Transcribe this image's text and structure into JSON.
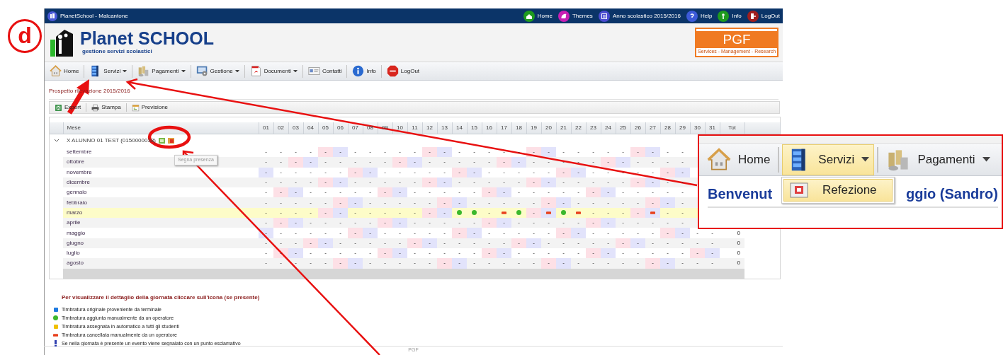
{
  "annotation": {
    "label": "d"
  },
  "window": {
    "title": "PlanetSchool - Malcantone"
  },
  "top_links": [
    {
      "label": "Home",
      "kind": "home",
      "color": "#1e9a1e"
    },
    {
      "label": "Themes",
      "kind": "themes",
      "color": "#c81eb4"
    },
    {
      "label": "Anno scolastico 2015/2016",
      "kind": "calendar",
      "color": "#4a4ad0"
    },
    {
      "label": "Help",
      "kind": "help",
      "color": "#3c5ad8"
    },
    {
      "label": "Info",
      "kind": "info",
      "color": "#1e9a1e"
    },
    {
      "label": "LogOut",
      "kind": "logout",
      "color": "#a01e1e"
    }
  ],
  "brand": {
    "title": "Planet SCHOOL",
    "subtitle": "gestione servizi scolastici"
  },
  "partner_logo": {
    "text": "PGF",
    "tagline": "Services - Management - Research"
  },
  "toolbar": [
    {
      "label": "Home",
      "kind": "home",
      "dropdown": false
    },
    {
      "label": "Servizi",
      "kind": "services",
      "dropdown": true
    },
    {
      "label": "Pagamenti",
      "kind": "payments",
      "dropdown": true
    },
    {
      "label": "Gestione",
      "kind": "management",
      "dropdown": true
    },
    {
      "label": "Documenti",
      "kind": "documents",
      "dropdown": true
    },
    {
      "label": "Contatti",
      "kind": "contacts",
      "dropdown": false
    },
    {
      "label": "Info",
      "kind": "info",
      "dropdown": false
    },
    {
      "label": "LogOut",
      "kind": "logout",
      "dropdown": false
    }
  ],
  "page_title": "Prospetto rilevazione 2015/2016",
  "actions": [
    {
      "label": "Export",
      "kind": "excel"
    },
    {
      "label": "Stampa",
      "kind": "print"
    },
    {
      "label": "Previsione",
      "kind": "forecast"
    }
  ],
  "grid": {
    "columns": [
      "Mese",
      "01",
      "02",
      "03",
      "04",
      "05",
      "06",
      "07",
      "08",
      "09",
      "10",
      "11",
      "12",
      "13",
      "14",
      "15",
      "16",
      "17",
      "18",
      "19",
      "20",
      "21",
      "22",
      "23",
      "24",
      "25",
      "26",
      "27",
      "28",
      "29",
      "30",
      "31",
      "Tot"
    ],
    "group": {
      "label": "X ALUNNO 01 TEST (0150000038)",
      "expanded": true
    },
    "tooltip": "Segna presenza",
    "rows": [
      {
        "selected": false,
        "cells": [
          "settembre",
          "-",
          "-",
          "-",
          "-",
          {
            "text": "-",
            "color": "#fde0e6"
          },
          {
            "text": "-",
            "color": "#e2e3fb"
          },
          "-",
          "-",
          "-",
          "-",
          "-",
          {
            "text": "-",
            "color": "#fde0e6"
          },
          {
            "text": "-",
            "color": "#e2e3fb"
          },
          "-",
          "-",
          "-",
          "-",
          "-",
          {
            "text": "-",
            "color": "#fde0e6"
          },
          {
            "text": "-",
            "color": "#e2e3fb"
          },
          "-",
          "-",
          "-",
          "-",
          "-",
          {
            "text": "-",
            "color": "#fde0e6"
          },
          {
            "text": "-",
            "color": "#e2e3fb"
          },
          "-",
          "-"
        ]
      },
      {
        "selected": false,
        "cells": [
          "ottobre",
          "-",
          "-",
          {
            "text": "-",
            "color": "#fde0e6"
          },
          {
            "text": "-",
            "color": "#e2e3fb"
          },
          "-",
          "-",
          "-",
          "-",
          "-",
          {
            "text": "-",
            "color": "#fde0e6"
          },
          {
            "text": "-",
            "color": "#e2e3fb"
          },
          "-",
          "-",
          "-",
          "-",
          "-",
          {
            "text": "-",
            "color": "#fde0e6"
          },
          {
            "text": "-",
            "color": "#e2e3fb"
          },
          "-",
          "-",
          "-",
          "-",
          "-",
          {
            "text": "-",
            "color": "#fde0e6"
          },
          {
            "text": "-",
            "color": "#e2e3fb"
          },
          "-",
          "-",
          "-",
          "-"
        ]
      },
      {
        "selected": false,
        "cells": [
          "novembre",
          {
            "text": "-",
            "color": "#e2e3fb"
          },
          "-",
          "-",
          "-",
          "-",
          "-",
          {
            "text": "-",
            "color": "#fde0e6"
          },
          {
            "text": "-",
            "color": "#e2e3fb"
          },
          "-",
          "-",
          "-",
          "-",
          "-",
          {
            "text": "-",
            "color": "#fde0e6"
          },
          {
            "text": "-",
            "color": "#e2e3fb"
          },
          "-",
          "-",
          "-",
          "-",
          "-",
          {
            "text": "-",
            "color": "#fde0e6"
          },
          {
            "text": "-",
            "color": "#e2e3fb"
          },
          "-",
          "-",
          "-",
          "-",
          "-",
          {
            "text": "-",
            "color": "#fde0e6"
          },
          {
            "text": "-",
            "color": "#e2e3fb"
          }
        ]
      },
      {
        "selected": false,
        "cells": [
          "dicembre",
          "-",
          "-",
          "-",
          "-",
          {
            "text": "-",
            "color": "#fde0e6"
          },
          {
            "text": "-",
            "color": "#e2e3fb"
          },
          "-",
          "-",
          "-",
          "-",
          "-",
          {
            "text": "-",
            "color": "#fde0e6"
          },
          {
            "text": "-",
            "color": "#e2e3fb"
          },
          "-",
          "-",
          "-",
          "-",
          "-",
          {
            "text": "-",
            "color": "#fde0e6"
          },
          {
            "text": "-",
            "color": "#e2e3fb"
          },
          "-",
          "-",
          "-",
          "-",
          "-",
          {
            "text": "-",
            "color": "#fde0e6"
          },
          {
            "text": "-",
            "color": "#e2e3fb"
          },
          "-",
          "-"
        ]
      },
      {
        "selected": false,
        "cells": [
          "gennaio",
          "-",
          {
            "text": "-",
            "color": "#fde0e6"
          },
          {
            "text": "-",
            "color": "#e2e3fb"
          },
          "-",
          "-",
          "-",
          "-",
          "-",
          {
            "text": "-",
            "color": "#fde0e6"
          },
          {
            "text": "-",
            "color": "#e2e3fb"
          },
          "-",
          "-",
          "-",
          "-",
          "-",
          {
            "text": "-",
            "color": "#fde0e6"
          },
          {
            "text": "-",
            "color": "#e2e3fb"
          },
          "-",
          "-",
          "-",
          "-",
          "-",
          {
            "text": "-",
            "color": "#fde0e6"
          },
          {
            "text": "-",
            "color": "#e2e3fb"
          },
          "-",
          "-",
          "-",
          "-",
          "-"
        ]
      },
      {
        "selected": false,
        "cells": [
          "febbraio",
          "-",
          "-",
          "-",
          "-",
          "-",
          {
            "text": "-",
            "color": "#fde0e6"
          },
          {
            "text": "-",
            "color": "#e2e3fb"
          },
          "-",
          "-",
          "-",
          "-",
          "-",
          {
            "text": "-",
            "color": "#fde0e6"
          },
          {
            "text": "-",
            "color": "#e2e3fb"
          },
          "-",
          "-",
          "-",
          "-",
          "-",
          {
            "text": "-",
            "color": "#fde0e6"
          },
          {
            "text": "-",
            "color": "#e2e3fb"
          },
          "-",
          "-",
          "-",
          "-",
          "-",
          {
            "text": "-",
            "color": "#fde0e6"
          },
          {
            "text": "-",
            "color": "#e2e3fb"
          },
          "-"
        ]
      },
      {
        "selected": true,
        "cells": [
          "marzo",
          "-",
          "-",
          "-",
          "-",
          {
            "text": "-",
            "color": "#fde0e6"
          },
          {
            "text": "-",
            "color": "#e2e3fb"
          },
          "-",
          "-",
          "-",
          "-",
          "-",
          {
            "text": "-",
            "color": "#fde0e6"
          },
          {
            "text": "-",
            "color": "#e2e3fb"
          },
          {
            "kind": "added"
          },
          {
            "kind": "added"
          },
          "-",
          {
            "kind": "cancelled"
          },
          {
            "kind": "added"
          },
          {
            "text": "-",
            "color": "#fde0e6"
          },
          {
            "kind": "cancelled",
            "color": "#e2e3fb"
          },
          {
            "kind": "added"
          },
          {
            "kind": "cancelled"
          },
          "-",
          "-",
          "-",
          {
            "text": "-",
            "color": "#fde0e6"
          },
          {
            "kind": "cancelled",
            "color": "#e2e3fb"
          },
          "-",
          "-"
        ]
      },
      {
        "selected": false,
        "cells": [
          "aprile",
          "-",
          {
            "text": "-",
            "color": "#fde0e6"
          },
          {
            "text": "-",
            "color": "#e2e3fb"
          },
          "-",
          "-",
          "-",
          "-",
          "-",
          {
            "text": "-",
            "color": "#fde0e6"
          },
          {
            "text": "-",
            "color": "#e2e3fb"
          },
          "-",
          "-",
          "-",
          "-",
          "-",
          {
            "text": "-",
            "color": "#fde0e6"
          },
          {
            "text": "-",
            "color": "#e2e3fb"
          },
          "-",
          "-",
          "-",
          "-",
          "-",
          {
            "text": "-",
            "color": "#fde0e6"
          },
          {
            "text": "-",
            "color": "#e2e3fb"
          },
          "-",
          "-",
          "-",
          "-",
          "-"
        ]
      },
      {
        "selected": false,
        "cells": [
          "maggio",
          {
            "text": "-",
            "color": "#e2e3fb"
          },
          "-",
          "-",
          "-",
          "-",
          "-",
          {
            "text": "-",
            "color": "#fde0e6"
          },
          {
            "text": "-",
            "color": "#e2e3fb"
          },
          "-",
          "-",
          "-",
          "-",
          "-",
          {
            "text": "-",
            "color": "#fde0e6"
          },
          {
            "text": "-",
            "color": "#e2e3fb"
          },
          "-",
          "-",
          "-",
          "-",
          "-",
          {
            "text": "-",
            "color": "#fde0e6"
          },
          {
            "text": "-",
            "color": "#e2e3fb"
          },
          "-",
          "-",
          "-",
          "-",
          "-",
          {
            "text": "-",
            "color": "#fde0e6"
          },
          {
            "text": "-",
            "color": "#e2e3fb"
          },
          "-",
          "-",
          "0"
        ]
      },
      {
        "selected": false,
        "cells": [
          "giugno",
          "-",
          "-",
          "-",
          {
            "text": "-",
            "color": "#fde0e6"
          },
          {
            "text": "-",
            "color": "#e2e3fb"
          },
          "-",
          "-",
          "-",
          "-",
          "-",
          {
            "text": "-",
            "color": "#fde0e6"
          },
          {
            "text": "-",
            "color": "#e2e3fb"
          },
          "-",
          "-",
          "-",
          "-",
          "-",
          {
            "text": "-",
            "color": "#fde0e6"
          },
          {
            "text": "-",
            "color": "#e2e3fb"
          },
          "-",
          "-",
          "-",
          "-",
          "-",
          {
            "text": "-",
            "color": "#fde0e6"
          },
          {
            "text": "-",
            "color": "#e2e3fb"
          },
          "-",
          "-",
          "-",
          "-",
          "-",
          "0"
        ]
      },
      {
        "selected": false,
        "cells": [
          "luglio",
          "-",
          {
            "text": "-",
            "color": "#fde0e6"
          },
          {
            "text": "-",
            "color": "#e2e3fb"
          },
          "-",
          "-",
          "-",
          "-",
          "-",
          {
            "text": "-",
            "color": "#fde0e6"
          },
          {
            "text": "-",
            "color": "#e2e3fb"
          },
          "-",
          "-",
          "-",
          "-",
          "-",
          {
            "text": "-",
            "color": "#fde0e6"
          },
          {
            "text": "-",
            "color": "#e2e3fb"
          },
          "-",
          "-",
          "-",
          "-",
          "-",
          {
            "text": "-",
            "color": "#fde0e6"
          },
          {
            "text": "-",
            "color": "#e2e3fb"
          },
          "-",
          "-",
          "-",
          "-",
          "-",
          {
            "text": "-",
            "color": "#fde0e6"
          },
          {
            "text": "-",
            "color": "#e2e3fb"
          },
          "0"
        ]
      },
      {
        "selected": false,
        "cells": [
          "agosto",
          "-",
          "-",
          "-",
          "-",
          "-",
          {
            "text": "-",
            "color": "#fde0e6"
          },
          {
            "text": "-",
            "color": "#e2e3fb"
          },
          "-",
          "-",
          "-",
          "-",
          "-",
          {
            "text": "-",
            "color": "#fde0e6"
          },
          {
            "text": "-",
            "color": "#e2e3fb"
          },
          "-",
          "-",
          "-",
          "-",
          "-",
          {
            "text": "-",
            "color": "#fde0e6"
          },
          {
            "text": "-",
            "color": "#e2e3fb"
          },
          "-",
          "-",
          "-",
          "-",
          "-",
          {
            "text": "-",
            "color": "#fde0e6"
          },
          {
            "text": "-",
            "color": "#e2e3fb"
          },
          "-",
          "-",
          "-",
          "0"
        ]
      }
    ]
  },
  "legend": {
    "title": "Per visualizzare il dettaglio della giornata cliccare sull'icona (se presente)",
    "items": [
      {
        "kind": "original",
        "text": "Timbratura originale proveniente da terminale"
      },
      {
        "kind": "added",
        "text": "Timbratura aggiunta manualmente da un operatore"
      },
      {
        "kind": "auto",
        "text": "Timbratura assegnata in automatico a tutti gli studenti"
      },
      {
        "kind": "cancelled",
        "text": "Timbratura cancellata manualmente da un operatore"
      },
      {
        "kind": "event",
        "text": "Se nella giornata è presente un evento viene segnalato con un punto esclamativo"
      }
    ]
  },
  "footer": "PGF",
  "inset": {
    "toolbar": [
      {
        "label": "Home",
        "kind": "home",
        "dropdown": false,
        "selected": false
      },
      {
        "label": "Servizi",
        "kind": "services",
        "dropdown": true,
        "selected": true
      },
      {
        "label": "Pagamenti",
        "kind": "payments",
        "dropdown": true,
        "selected": false
      }
    ],
    "menu": [
      {
        "label": "Refezione",
        "selected": true
      }
    ],
    "heading_start": "Benvenut",
    "heading_end": "ggio (Sandro)"
  }
}
